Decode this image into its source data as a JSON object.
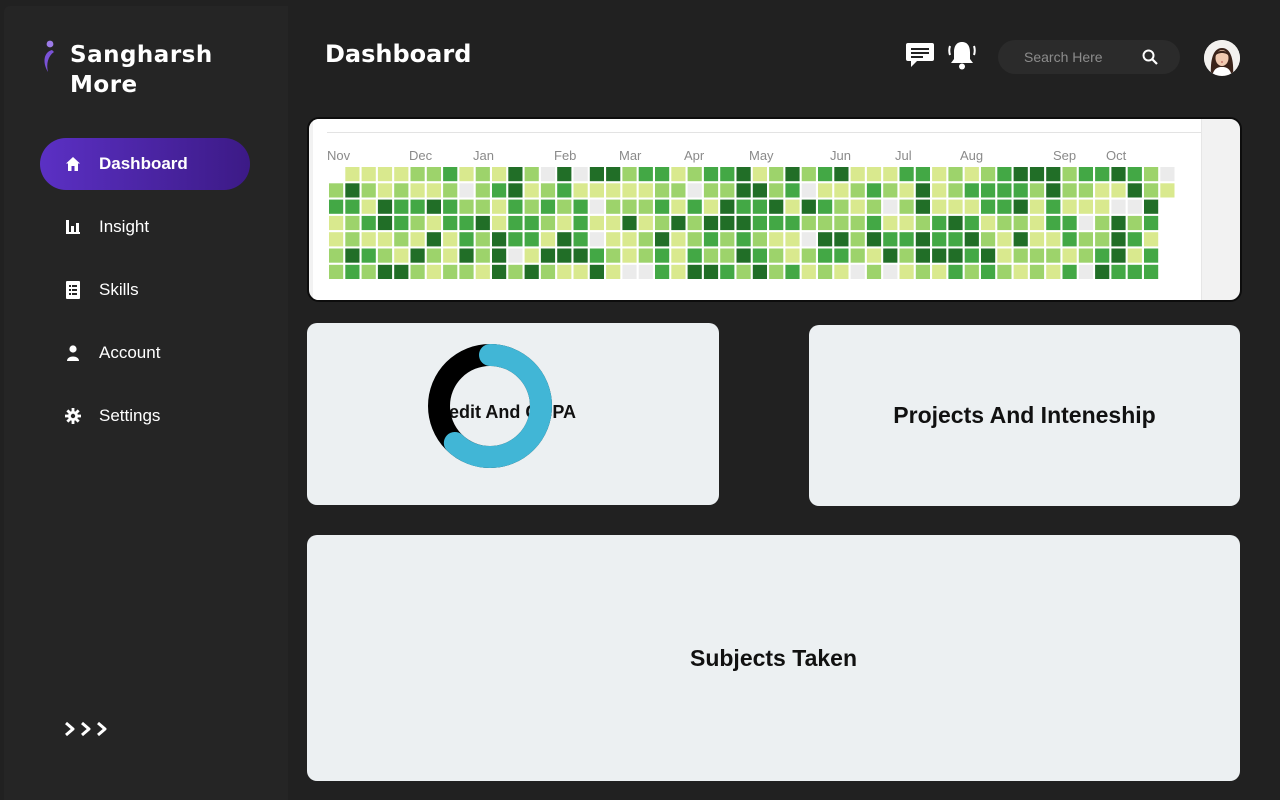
{
  "app": {
    "brand_line1": "Sangharsh",
    "brand_line2": "More",
    "accent_color": "#5b30c4"
  },
  "sidebar": {
    "items": [
      {
        "label": "Dashboard",
        "icon": "home-icon",
        "active": true
      },
      {
        "label": "Insight",
        "icon": "bar-chart-icon",
        "active": false
      },
      {
        "label": "Skills",
        "icon": "document-icon",
        "active": false
      },
      {
        "label": "Account",
        "icon": "user-icon",
        "active": false
      },
      {
        "label": "Settings",
        "icon": "gear-icon",
        "active": false
      }
    ],
    "expand_icon": "triple-chevron-right-icon"
  },
  "header": {
    "title": "Dashboard",
    "messages_icon": "chat-icon",
    "notifications_icon": "bell-icon",
    "search_placeholder": "Search Here",
    "search_icon": "search-icon",
    "avatar_icon": "user-avatar"
  },
  "activity": {
    "months": [
      "Nov",
      "Dec",
      "Jan",
      "Feb",
      "Mar",
      "Apr",
      "May",
      "Jun",
      "Jul",
      "Aug",
      "Sep",
      "Oct"
    ],
    "colors": [
      "#ebebeb",
      "#d9e98e",
      "#9dd36b",
      "#43a845",
      "#216e27"
    ]
  },
  "cards": {
    "cgpa_title": "Credit And CGPA",
    "projects_title": "Projects And Inteneship",
    "subjects_title": "Subjects Taken"
  },
  "cgpa_donut": {
    "filled_fraction": 0.62,
    "filled_color": "#41b6d6",
    "track_color": "#000000"
  }
}
